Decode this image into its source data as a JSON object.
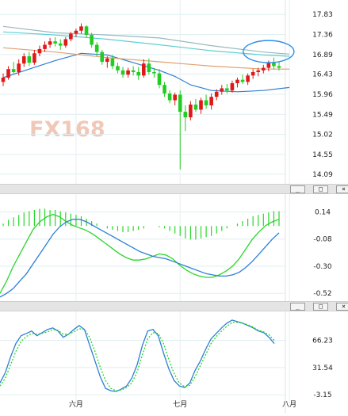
{
  "watermark": "FX168",
  "panel_buttons": [
    "_",
    "□",
    "×"
  ],
  "chart_data": [
    {
      "type": "candlestick",
      "name": "price",
      "yticks": [
        17.83,
        17.36,
        16.89,
        16.43,
        15.96,
        15.49,
        15.02,
        14.55,
        14.09
      ],
      "ylim": [
        13.9,
        18.02
      ],
      "xlabels": [
        {
          "label": "六月",
          "index": 14
        },
        {
          "label": "七月",
          "index": 34
        },
        {
          "label": "八月",
          "index": 55
        }
      ],
      "candles": [
        [
          16.25,
          16.45,
          16.15,
          16.35
        ],
        [
          16.35,
          16.62,
          16.3,
          16.55
        ],
        [
          16.55,
          16.72,
          16.42,
          16.48
        ],
        [
          16.48,
          16.78,
          16.4,
          16.68
        ],
        [
          16.68,
          16.92,
          16.6,
          16.85
        ],
        [
          16.85,
          16.95,
          16.62,
          16.7
        ],
        [
          16.7,
          17.0,
          16.65,
          16.92
        ],
        [
          16.92,
          17.1,
          16.85,
          17.02
        ],
        [
          17.02,
          17.2,
          16.95,
          17.12
        ],
        [
          17.12,
          17.28,
          17.05,
          17.2
        ],
        [
          17.2,
          17.3,
          17.08,
          17.15
        ],
        [
          17.15,
          17.25,
          17.0,
          17.1
        ],
        [
          17.1,
          17.3,
          17.05,
          17.25
        ],
        [
          17.25,
          17.42,
          17.2,
          17.38
        ],
        [
          17.38,
          17.5,
          17.3,
          17.45
        ],
        [
          17.45,
          17.62,
          17.38,
          17.55
        ],
        [
          17.55,
          17.58,
          17.28,
          17.35
        ],
        [
          17.35,
          17.4,
          17.05,
          17.12
        ],
        [
          17.12,
          17.18,
          16.85,
          16.95
        ],
        [
          16.95,
          17.0,
          16.65,
          16.72
        ],
        [
          16.72,
          16.85,
          16.58,
          16.8
        ],
        [
          16.8,
          16.88,
          16.55,
          16.62
        ],
        [
          16.62,
          16.7,
          16.45,
          16.52
        ],
        [
          16.52,
          16.6,
          16.35,
          16.42
        ],
        [
          16.42,
          16.58,
          16.35,
          16.52
        ],
        [
          16.52,
          16.62,
          16.4,
          16.48
        ],
        [
          16.48,
          16.6,
          16.3,
          16.4
        ],
        [
          16.4,
          16.78,
          16.35,
          16.68
        ],
        [
          16.68,
          16.8,
          16.42,
          16.48
        ],
        [
          16.48,
          16.58,
          16.35,
          16.45
        ],
        [
          16.45,
          16.55,
          16.1,
          16.18
        ],
        [
          16.18,
          16.25,
          15.9,
          15.98
        ],
        [
          15.98,
          16.05,
          15.75,
          15.82
        ],
        [
          15.82,
          16.0,
          15.7,
          15.95
        ],
        [
          15.95,
          16.05,
          14.2,
          15.55
        ],
        [
          15.55,
          15.7,
          15.1,
          15.42
        ],
        [
          15.42,
          15.8,
          15.35,
          15.72
        ],
        [
          15.72,
          15.85,
          15.55,
          15.6
        ],
        [
          15.6,
          15.88,
          15.5,
          15.82
        ],
        [
          15.82,
          15.95,
          15.62,
          15.7
        ],
        [
          15.7,
          15.98,
          15.6,
          15.9
        ],
        [
          15.9,
          16.08,
          15.82,
          16.02
        ],
        [
          16.02,
          16.18,
          15.95,
          16.1
        ],
        [
          16.1,
          16.2,
          15.98,
          16.05
        ],
        [
          16.05,
          16.28,
          16.0,
          16.22
        ],
        [
          16.22,
          16.35,
          16.12,
          16.3
        ],
        [
          16.3,
          16.42,
          16.2,
          16.25
        ],
        [
          16.25,
          16.45,
          16.18,
          16.4
        ],
        [
          16.4,
          16.55,
          16.32,
          16.48
        ],
        [
          16.48,
          16.58,
          16.38,
          16.52
        ],
        [
          16.52,
          16.65,
          16.45,
          16.58
        ],
        [
          16.58,
          16.75,
          16.5,
          16.7
        ],
        [
          16.7,
          16.82,
          16.55,
          16.62
        ],
        [
          16.62,
          16.72,
          16.52,
          16.58
        ]
      ],
      "overlays": [
        {
          "name": "ma_blue",
          "color": "#2d7fd6",
          "points": [
            [
              0,
              16.35
            ],
            [
              5,
              16.55
            ],
            [
              10,
              16.75
            ],
            [
              15,
              16.92
            ],
            [
              20,
              16.88
            ],
            [
              25,
              16.7
            ],
            [
              30,
              16.52
            ],
            [
              33,
              16.38
            ],
            [
              36,
              16.18
            ],
            [
              40,
              16.05
            ],
            [
              45,
              16.02
            ],
            [
              50,
              16.05
            ],
            [
              55,
              16.12
            ]
          ]
        },
        {
          "name": "ma_tan",
          "color": "#e0a070",
          "points": [
            [
              0,
              17.05
            ],
            [
              10,
              16.95
            ],
            [
              20,
              16.82
            ],
            [
              30,
              16.72
            ],
            [
              40,
              16.62
            ],
            [
              50,
              16.55
            ],
            [
              55,
              16.55
            ]
          ]
        },
        {
          "name": "ma_cyan",
          "color": "#5fcfd2",
          "points": [
            [
              0,
              17.42
            ],
            [
              10,
              17.35
            ],
            [
              20,
              17.25
            ],
            [
              30,
              17.12
            ],
            [
              40,
              16.98
            ],
            [
              50,
              16.88
            ],
            [
              55,
              16.85
            ]
          ]
        },
        {
          "name": "ma_gray",
          "color": "#9bb8bd",
          "points": [
            [
              0,
              17.55
            ],
            [
              10,
              17.4
            ],
            [
              20,
              17.35
            ],
            [
              30,
              17.28
            ],
            [
              40,
              17.1
            ],
            [
              50,
              16.95
            ],
            [
              55,
              16.9
            ]
          ]
        }
      ],
      "annotation": {
        "shape": "ellipse",
        "color": "#2b8fe8",
        "center_index": 51,
        "center_value": 16.96,
        "rx": 32,
        "ry": 14
      }
    },
    {
      "type": "histogram-lines",
      "name": "macd",
      "yticks": [
        0.14,
        -0.08,
        -0.3,
        -0.52
      ],
      "ylim": [
        -0.57,
        0.22
      ],
      "bars": [
        0.02,
        0.05,
        0.07,
        0.09,
        0.11,
        0.12,
        0.13,
        0.14,
        0.14,
        0.13,
        0.13,
        0.12,
        0.11,
        0.1,
        0.09,
        0.08,
        0.06,
        0.04,
        0.02,
        0.0,
        -0.02,
        -0.03,
        -0.04,
        -0.05,
        -0.05,
        -0.04,
        -0.03,
        -0.02,
        0.0,
        0.0,
        -0.01,
        -0.02,
        -0.04,
        -0.06,
        -0.08,
        -0.1,
        -0.11,
        -0.11,
        -0.1,
        -0.09,
        -0.08,
        -0.06,
        -0.04,
        -0.02,
        0.0,
        0.02,
        0.04,
        0.06,
        0.08,
        0.09,
        0.1,
        0.11,
        0.12,
        0.12
      ],
      "series": [
        {
          "name": "dif",
          "color": "#29d629",
          "values": [
            -0.52,
            -0.42,
            -0.3,
            -0.2,
            -0.1,
            0.0,
            0.06,
            0.1,
            0.12,
            0.1,
            0.06,
            0.03,
            0.01,
            -0.01,
            -0.04,
            -0.08,
            -0.12,
            -0.16,
            -0.2,
            -0.23,
            -0.25,
            -0.25,
            -0.24,
            -0.22,
            -0.2,
            -0.21,
            -0.24,
            -0.29,
            -0.33,
            -0.36,
            -0.38,
            -0.39,
            -0.39,
            -0.37,
            -0.34,
            -0.3,
            -0.24,
            -0.16,
            -0.08,
            -0.02,
            0.03,
            0.06,
            0.08
          ]
        },
        {
          "name": "dea",
          "color": "#2d7fd6",
          "values": [
            -0.55,
            -0.52,
            -0.48,
            -0.42,
            -0.36,
            -0.28,
            -0.2,
            -0.12,
            -0.04,
            0.02,
            0.06,
            0.08,
            0.08,
            0.06,
            0.03,
            0.0,
            -0.03,
            -0.06,
            -0.09,
            -0.12,
            -0.15,
            -0.18,
            -0.2,
            -0.22,
            -0.23,
            -0.24,
            -0.26,
            -0.28,
            -0.3,
            -0.32,
            -0.34,
            -0.36,
            -0.37,
            -0.38,
            -0.38,
            -0.37,
            -0.35,
            -0.31,
            -0.26,
            -0.2,
            -0.14,
            -0.08,
            -0.03
          ]
        }
      ]
    },
    {
      "type": "line",
      "name": "stochastic",
      "yticks": [
        66.23,
        31.54,
        -3.15
      ],
      "ylim": [
        -8,
        102
      ],
      "series": [
        {
          "name": "k",
          "color": "#2d7fd6",
          "values": [
            12,
            25,
            45,
            62,
            72,
            75,
            78,
            72,
            76,
            80,
            82,
            78,
            70,
            74,
            80,
            85,
            80,
            60,
            40,
            20,
            5,
            2,
            1,
            4,
            8,
            18,
            35,
            60,
            78,
            80,
            72,
            50,
            30,
            15,
            8,
            6,
            12,
            28,
            40,
            55,
            68,
            75,
            82,
            88,
            92,
            90,
            88,
            85,
            82,
            78,
            76,
            70,
            62
          ]
        },
        {
          "name": "d",
          "color": "#29d629",
          "values": [
            8,
            18,
            35,
            52,
            65,
            71,
            75,
            74,
            75,
            77,
            80,
            79,
            74,
            74,
            77,
            81,
            80,
            70,
            52,
            32,
            15,
            5,
            2,
            3,
            6,
            12,
            26,
            48,
            68,
            76,
            75,
            62,
            42,
            24,
            12,
            7,
            9,
            20,
            34,
            48,
            62,
            71,
            78,
            84,
            89,
            89,
            88,
            86,
            83,
            79,
            77,
            73,
            66
          ]
        }
      ]
    }
  ]
}
